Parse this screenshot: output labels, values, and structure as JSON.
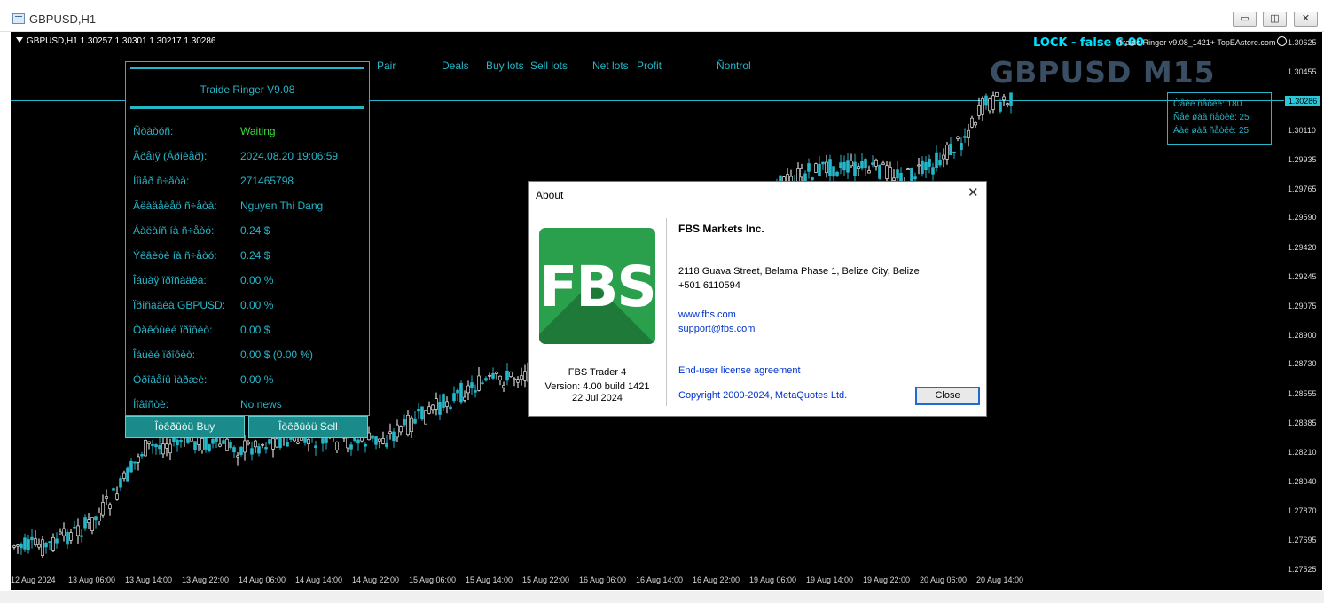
{
  "window": {
    "title": "GBPUSD,H1",
    "minimize": "▭",
    "restore": "◫",
    "close": "✕"
  },
  "chart": {
    "symbol_info": "GBPUSD,H1  1.30257 1.30301 1.30217 1.30286",
    "watermark": "GBPUSD M15",
    "lock_text": "LOCK  -  false  6.00",
    "ea_info": "Traide Ringer v9.08_1421+ TopEAstore.com",
    "colors": {
      "background": "#000000",
      "bull_candle": "#26b6c9",
      "bear_candle": "#ffffff",
      "accent": "#26b6c9"
    },
    "columns": [
      "Pair",
      "Deals",
      "Buy lots",
      "Sell lots",
      "Net lots",
      "Profit",
      "Ñontrol"
    ],
    "price_axis": [
      "1.30625",
      "1.30455",
      "1.30110",
      "1.29935",
      "1.29765",
      "1.29590",
      "1.29420",
      "1.29245",
      "1.29075",
      "1.28900",
      "1.28730",
      "1.28555",
      "1.28385",
      "1.28210",
      "1.28040",
      "1.27870",
      "1.27695",
      "1.27525"
    ],
    "current_price": "1.30286",
    "time_axis": [
      "12 Aug 2024",
      "13 Aug 06:00",
      "13 Aug 14:00",
      "13 Aug 22:00",
      "14 Aug 06:00",
      "14 Aug 14:00",
      "14 Aug 22:00",
      "15 Aug 06:00",
      "15 Aug 14:00",
      "15 Aug 22:00",
      "16 Aug 06:00",
      "16 Aug 14:00",
      "16 Aug 22:00",
      "19 Aug 06:00",
      "19 Aug 14:00",
      "19 Aug 22:00",
      "20 Aug 06:00",
      "20 Aug 14:00"
    ]
  },
  "panel": {
    "title": "Traide Ringer V9.08",
    "rows": [
      {
        "label": "Ñòàòóñ:",
        "value": "Waiting"
      },
      {
        "label": "Âðåìÿ (Áðîêåð):",
        "value": "2024.08.20 19:06:59"
      },
      {
        "label": "Íîìåð ñ÷åòà:",
        "value": "271465798"
      },
      {
        "label": "Âëàäåëåö ñ÷åòà:",
        "value": "Nguyen Thi Dang"
      },
      {
        "label": "Áàëàíñ íà ñ÷åòó:",
        "value": "0.24 $"
      },
      {
        "label": "Ýêâèòè íà ñ÷åòó:",
        "value": "0.24 $"
      },
      {
        "label": "Îáùàÿ ïðîñàäêà:",
        "value": "0.00 %"
      },
      {
        "label": "Ïðîñàäêà GBPUSD:",
        "value": "0.00 %"
      },
      {
        "label": "Òåêóùèé ïðîôèò:",
        "value": "0.00 $"
      },
      {
        "label": "Îáùèé ïðîôèò:",
        "value": "0.00 $  (0.00 %)"
      },
      {
        "label": "Óðîâåíü ìàðæè:",
        "value": "0.00 %"
      },
      {
        "label": "Íîâîñòè:",
        "value": "No news"
      }
    ],
    "buy_button": "Îòêðûòü Buy",
    "sell_button": "Îòêðûòü Sell",
    "status_color": "#3ddc3d"
  },
  "stats": [
    "Òåêë ñåòêè: 180",
    "Ñåê øàã ñåòêè: 25",
    "Áàé øàã ñåòêè: 25"
  ],
  "about": {
    "title": "About",
    "company": "FBS Markets Inc.",
    "address": "2118 Guava Street, Belama Phase 1, Belize City, Belize",
    "phone": "+501 6110594",
    "website": "www.fbs.com",
    "email": "support@fbs.com",
    "license": "End-user license agreement",
    "copyright": "Copyright 2000-2024, MetaQuotes Ltd.",
    "product": "FBS Trader 4",
    "version": "Version: 4.00 build 1421",
    "date": "22 Jul 2024",
    "logo_text": "FBS",
    "close_button": "Close",
    "close_icon": "✕",
    "brand_color": "#2a9f4c"
  }
}
